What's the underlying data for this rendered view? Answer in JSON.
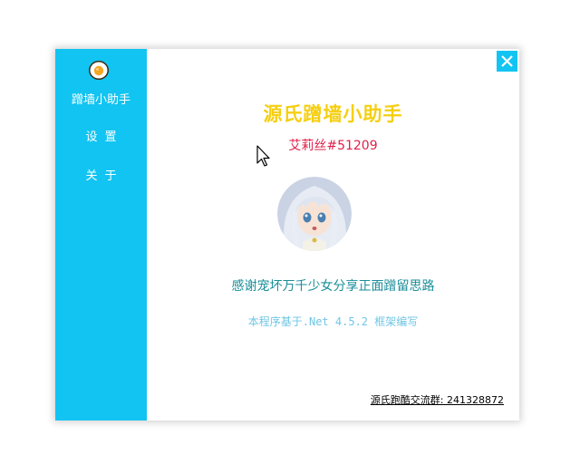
{
  "sidebar": {
    "logo_icon": "egg-logo-icon",
    "items": [
      {
        "label": "蹭墙小助手"
      },
      {
        "label": "设置"
      },
      {
        "label": "关于"
      }
    ],
    "color": "#12c4f2"
  },
  "window": {
    "close_icon": "close-icon"
  },
  "main": {
    "title": "源氏蹭墙小助手",
    "username": "艾莉丝#51209",
    "avatar_icon": "anime-girl-avatar",
    "thanks_text": "感谢宠坏万千少女分享正面蹭留思路",
    "framework_text": "本程序基于.Net 4.5.2 框架编写",
    "group_link": "源氏跑酷交流群: 241328872"
  },
  "colors": {
    "accent": "#12c4f2",
    "title": "#f5cf12",
    "username": "#e0204a",
    "thanks": "#1a8e9a",
    "framework": "#6fc6e6"
  }
}
